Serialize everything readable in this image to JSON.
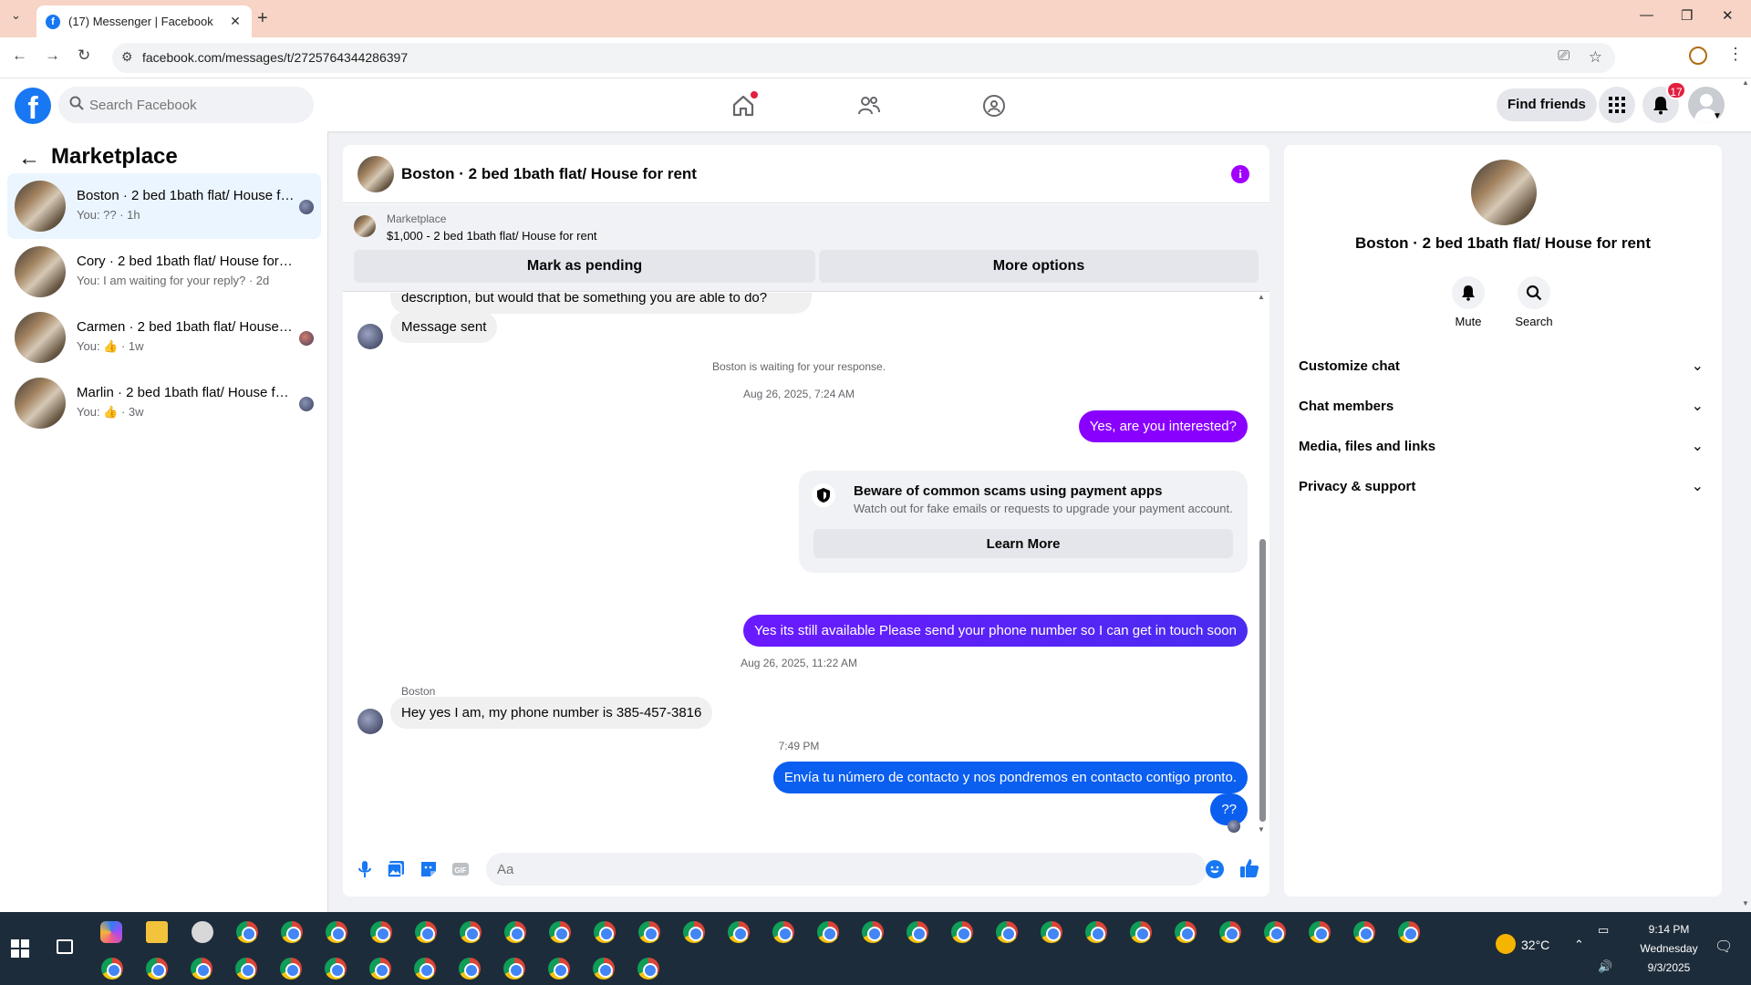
{
  "browser": {
    "tab_title": "(17) Messenger | Facebook",
    "tab_favicon": "f",
    "url": "facebook.com/messages/t/2725764344286397"
  },
  "fb_header": {
    "logo": "f",
    "search_placeholder": "Search Facebook",
    "find_friends": "Find friends",
    "notification_count": "17"
  },
  "sidebar": {
    "title": "Marketplace",
    "conversations": [
      {
        "name": "Boston · 2 bed 1bath flat/ House for rent",
        "sub": "You: ?? · 1h",
        "active": true
      },
      {
        "name": "Cory · 2 bed 1bath flat/ House for rent",
        "sub": "You: I am waiting for your reply? · 2d",
        "active": false
      },
      {
        "name": "Carmen · 2 bed 1bath flat/ House for rent",
        "sub": "You: 👍 · 1w",
        "active": false
      },
      {
        "name": "Marlin · 2 bed 1bath flat/ House for rent",
        "sub": "You: 👍 · 3w",
        "active": false
      }
    ]
  },
  "chat": {
    "title": "Boston · 2 bed 1bath flat/ House for rent",
    "listing": {
      "source": "Marketplace",
      "price_title": "$1,000 - 2 bed 1bath flat/ House for rent",
      "btn_pending": "Mark as pending",
      "btn_more": "More options"
    },
    "messages": {
      "partial_in": "description, but would that be something you are able to do?",
      "msg_sent": "Message sent",
      "waiting_note": "Boston is waiting for your response.",
      "ts1": "Aug 26, 2025, 7:24 AM",
      "out1": "Yes, are you interested?",
      "scam_title": "Beware of common scams using payment apps",
      "scam_desc": "Watch out for fake emails or requests to upgrade your payment account.",
      "learn_more": "Learn More",
      "out2": "Yes its still available Please send your phone number so I can get in touch soon",
      "ts2": "Aug 26, 2025, 11:22 AM",
      "sender": "Boston",
      "in2": "Hey yes I am, my phone number is 385-457-3816",
      "ts3": "7:49 PM",
      "out3": "Envía tu número de contacto y nos pondremos en contacto contigo pronto.",
      "out4": "??"
    },
    "composer_placeholder": "Aa"
  },
  "info_panel": {
    "title": "Boston · 2 bed 1bath flat/ House for rent",
    "mute": "Mute",
    "search": "Search",
    "items": [
      "Customize chat",
      "Chat members",
      "Media, files and links",
      "Privacy & support"
    ]
  },
  "taskbar": {
    "temperature": "32°C",
    "time": "9:14 PM",
    "day": "Wednesday",
    "date": "9/3/2025"
  },
  "colors": {
    "fb_blue": "#1877f2",
    "purple_bubble": "#8a00ff",
    "blue_bubble": "#0a5ef0",
    "notif_red": "#e41e3f"
  }
}
